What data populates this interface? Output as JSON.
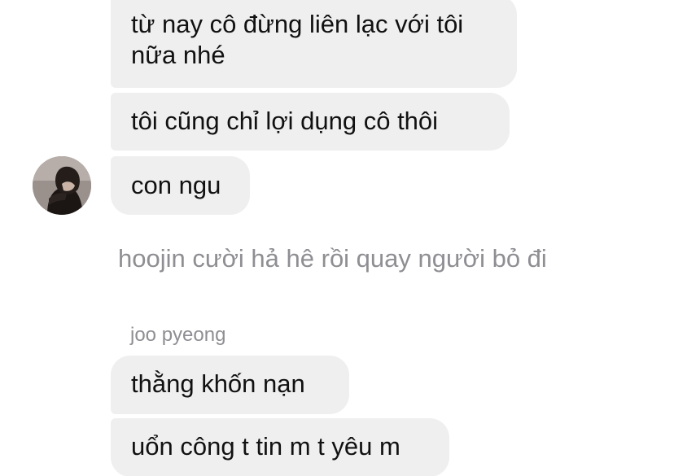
{
  "messages": [
    {
      "text": "từ nay cô đừng liên lạc với tôi nữa nhé"
    },
    {
      "text": "tôi cũng chỉ lợi dụng cô thôi"
    },
    {
      "text": "con ngu"
    },
    {
      "text": "thằng khốn nạn"
    },
    {
      "text": "uổn công t tin m t yêu m"
    }
  ],
  "narration": "hoojin cười hả hê rồi quay người bỏ đi",
  "second_sender": "joo pyeong",
  "colors": {
    "bubble": "#efeff0",
    "text": "#111111",
    "muted": "#8e8e93",
    "background": "#ffffff"
  },
  "icons": {
    "avatar": "profile-photo-avatar"
  }
}
